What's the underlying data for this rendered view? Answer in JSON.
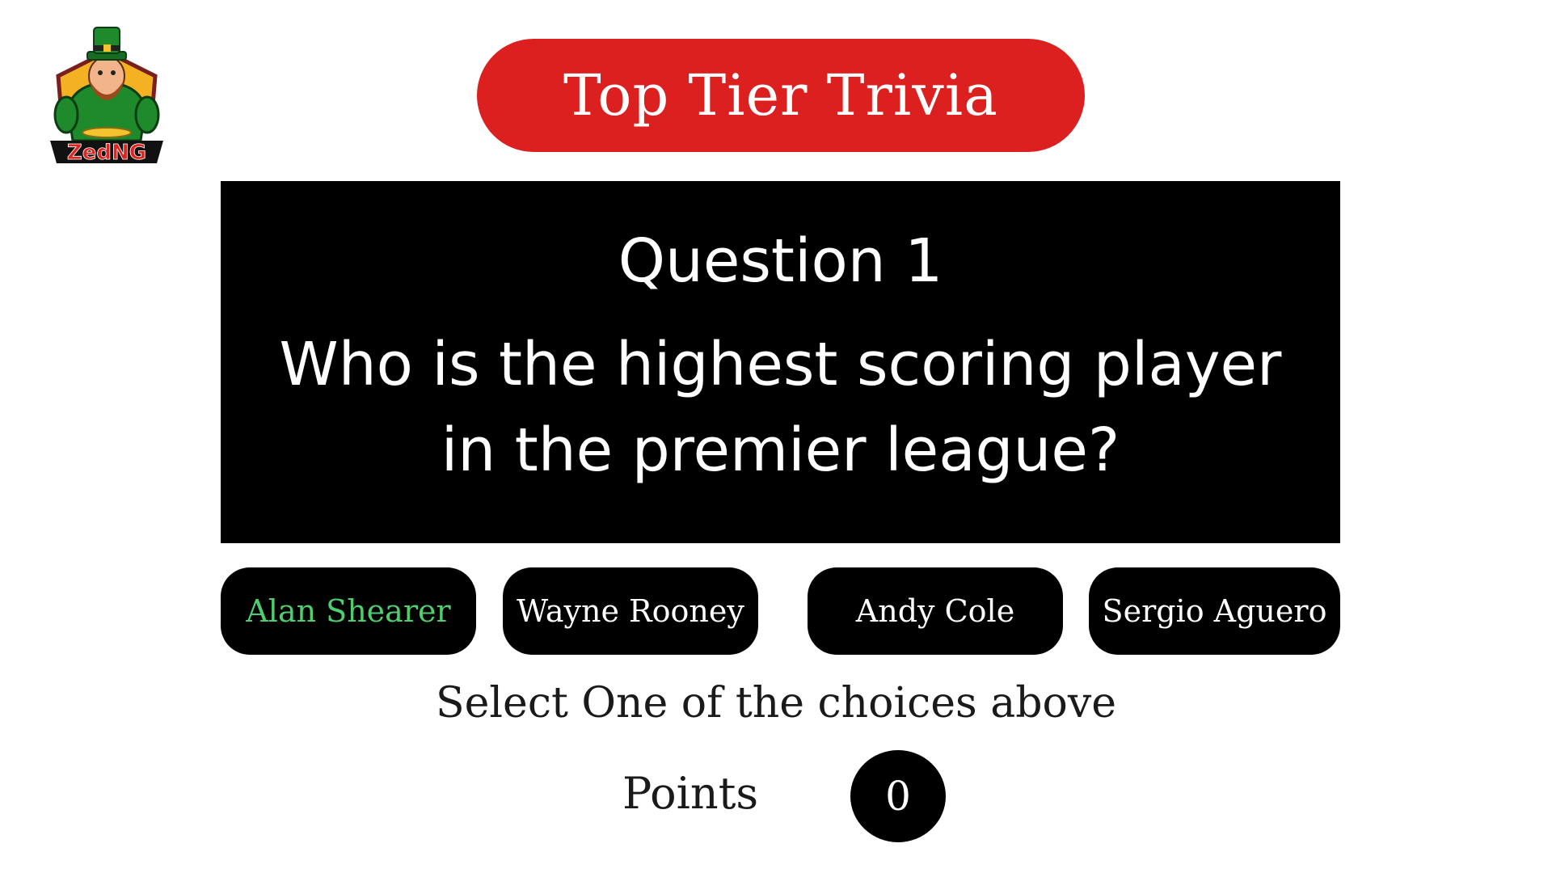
{
  "logo": {
    "text": "ZedNG",
    "icon": "leprechaun-mascot-icon"
  },
  "header": {
    "title": "Top Tier Trivia",
    "title_color": "#dc1f1f"
  },
  "question": {
    "number_label": "Question 1",
    "text": "Who is the highest scoring player in the premier league?"
  },
  "answers": [
    {
      "label": "Alan Shearer",
      "state": "correct",
      "text_color": "#4fce6d"
    },
    {
      "label": "Wayne Rooney",
      "state": "default",
      "text_color": "#ffffff"
    },
    {
      "label": "Andy Cole",
      "state": "default",
      "text_color": "#ffffff"
    },
    {
      "label": "Sergio Aguero",
      "state": "default",
      "text_color": "#ffffff"
    }
  ],
  "instruction": "Select One of the choices above",
  "score": {
    "label": "Points",
    "value": "0"
  }
}
